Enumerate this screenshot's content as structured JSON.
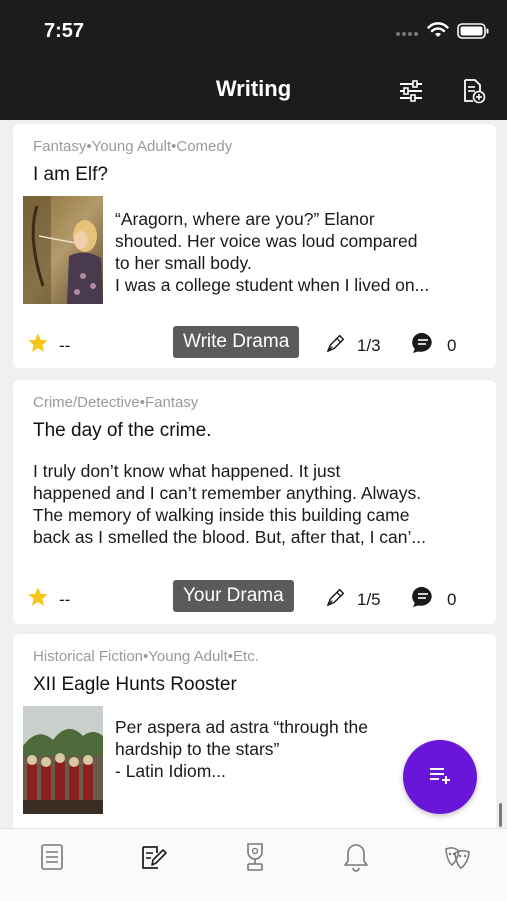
{
  "status_bar": {
    "time": "7:57"
  },
  "nav": {
    "title": "Writing",
    "filter_icon": "sliders-icon",
    "new_icon": "new-document-icon"
  },
  "stories": [
    {
      "genres": "Fantasy•Young Adult•Comedy",
      "title": "I am Elf?",
      "excerpt": [
        "“Aragorn, where are you?” Elanor",
        "shouted. Her voice was loud compared",
        "to her small body.",
        "I was a college student when I lived on..."
      ],
      "rating": "--",
      "drama_button": "Write Drama",
      "edits": "1/3",
      "comments": "0"
    },
    {
      "genres": "Crime/Detective•Fantasy",
      "title": "The day of the crime.",
      "excerpt": [
        "I truly don’t know what happened. It just",
        "happened and I can’t remember anything. Always.",
        "The memory of walking inside this building came",
        "back as I smelled the blood. But, after that, I can’..."
      ],
      "rating": "--",
      "drama_button": "Your Drama",
      "edits": "1/5",
      "comments": "0"
    },
    {
      "genres": "Historical Fiction•Young Adult•Etc.",
      "title": "XII Eagle Hunts Rooster",
      "excerpt": [
        "Per aspera ad astra “through the",
        "hardship to the stars”",
        "- Latin Idiom..."
      ]
    }
  ],
  "colors": {
    "accent": "#6a16d8",
    "star": "#f5c518",
    "header": "#1c1c1c",
    "button": "#5b5b5b"
  },
  "tabs": [
    {
      "name": "feed",
      "icon": "document-icon"
    },
    {
      "name": "writing",
      "icon": "write-icon"
    },
    {
      "name": "ranking",
      "icon": "trophy-icon"
    },
    {
      "name": "notifications",
      "icon": "bell-icon"
    },
    {
      "name": "profile",
      "icon": "mask-icon"
    }
  ]
}
